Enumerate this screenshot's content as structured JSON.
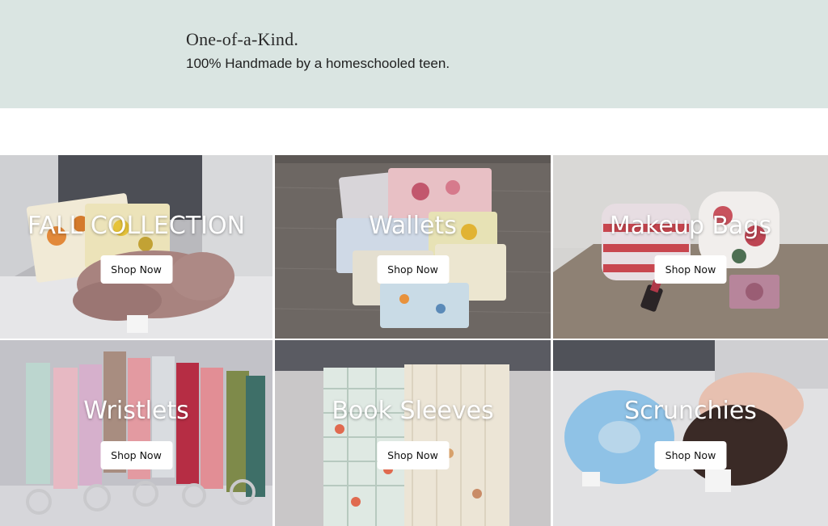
{
  "hero": {
    "title": "One-of-a-Kind.",
    "subtitle": "100% Handmade by a homeschooled teen."
  },
  "tiles": [
    {
      "title": "FALL COLLECTION",
      "button": "Shop Now"
    },
    {
      "title": "Wallets",
      "button": "Shop Now"
    },
    {
      "title": "Makeup Bags",
      "button": "Shop Now"
    },
    {
      "title": "Wristlets",
      "button": "Shop Now"
    },
    {
      "title": "Book Sleeves",
      "button": "Shop Now"
    },
    {
      "title": "Scrunchies",
      "button": "Shop Now"
    }
  ],
  "colors": {
    "hero_bg": "#dae5e2",
    "button_bg": "#ffffff"
  }
}
